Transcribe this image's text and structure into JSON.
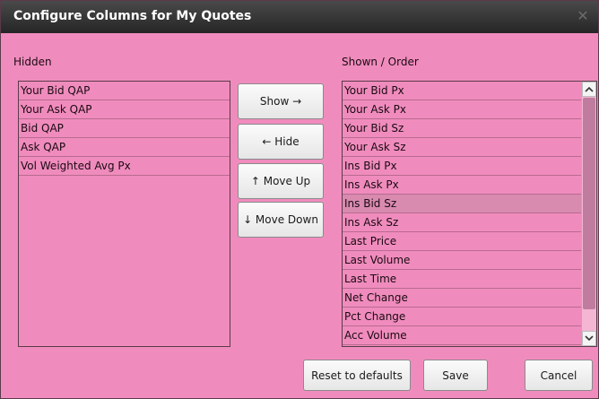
{
  "dialog": {
    "title": "Configure Columns for My Quotes",
    "close_icon": "close-icon"
  },
  "hidden": {
    "label": "Hidden",
    "items": [
      "Your Bid QAP",
      "Your Ask QAP",
      "Bid QAP",
      "Ask QAP",
      "Vol Weighted Avg Px"
    ]
  },
  "shown": {
    "label": "Shown / Order",
    "items": [
      "Your Bid Px",
      "Your Ask Px",
      "Your Bid Sz",
      "Your Ask Sz",
      "Ins Bid Px",
      "Ins Ask Px",
      "Ins Bid Sz",
      "Ins Ask Sz",
      "Last Price",
      "Last Volume",
      "Last Time",
      "Net Change",
      "Pct Change",
      "Acc Volume"
    ],
    "selected_item": "Ins Bid Sz"
  },
  "buttons": {
    "show": "Show →",
    "hide": "← Hide",
    "move_up": "↑ Move Up",
    "move_down": "↓ Move Down",
    "reset": "Reset to defaults",
    "save": "Save",
    "cancel": "Cancel"
  },
  "colors": {
    "background": "#f08cbd",
    "titlebar": "#2e2e2e",
    "selected_row": "#d88aaf"
  }
}
